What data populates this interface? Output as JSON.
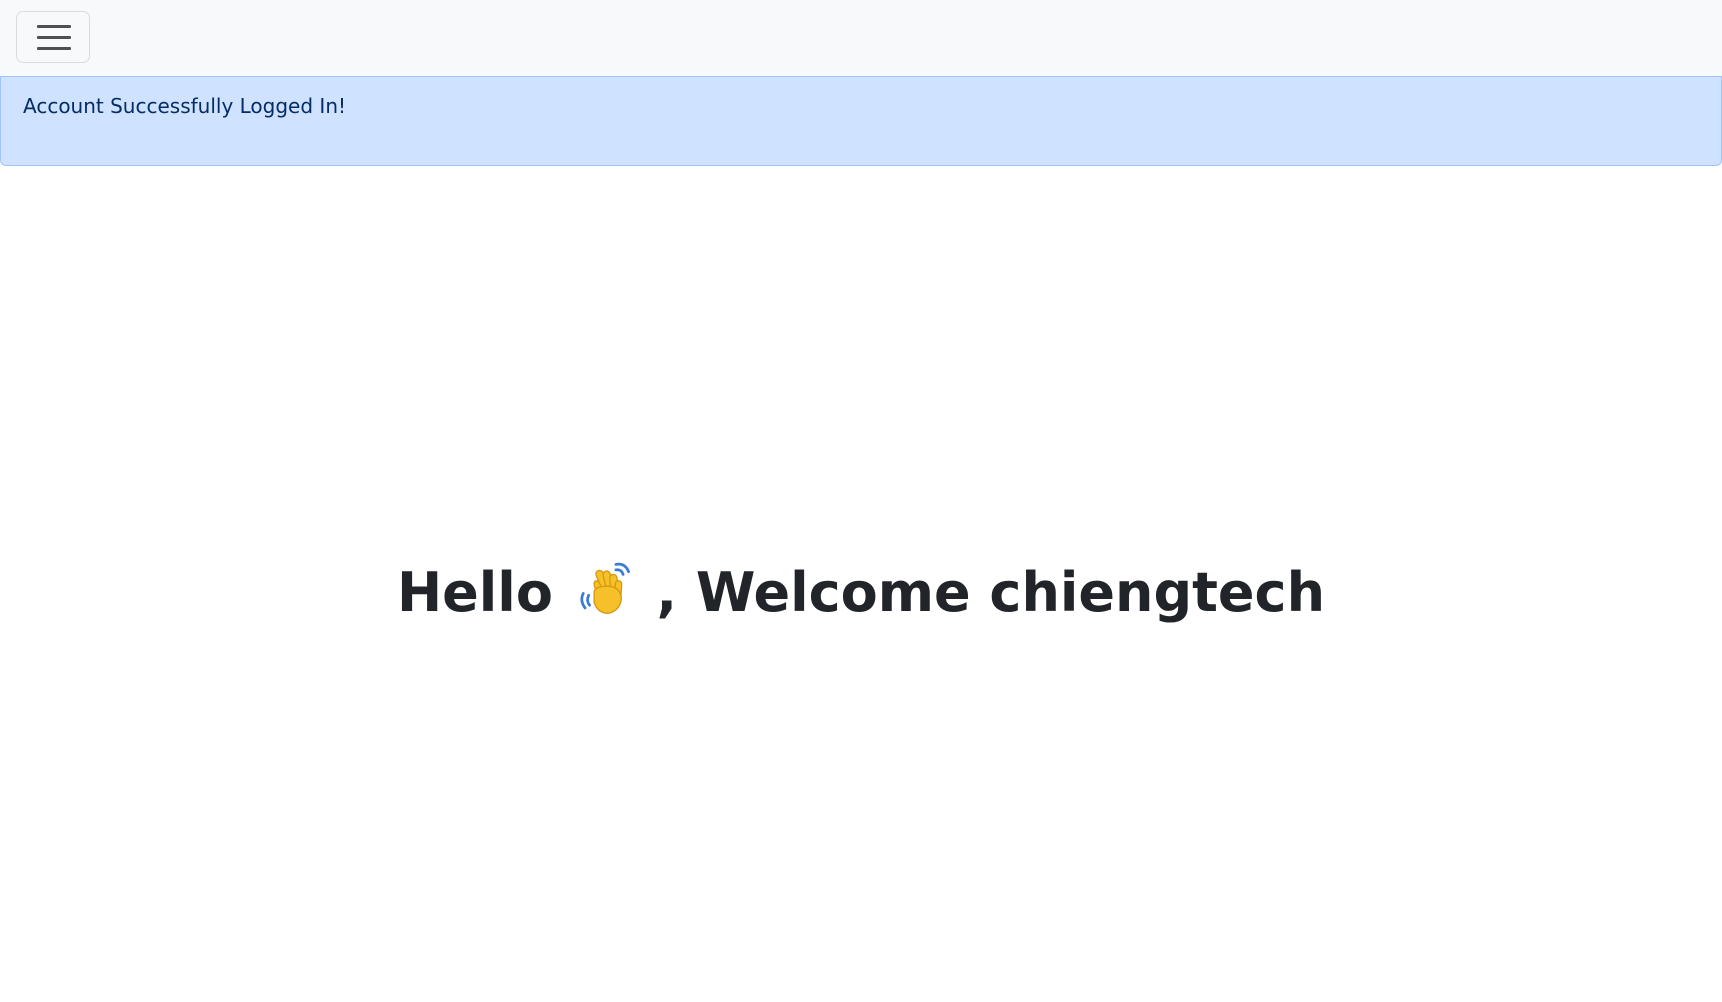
{
  "navbar": {
    "toggler_icon": "hamburger-menu-icon"
  },
  "alert": {
    "message": "Account Successfully Logged In!"
  },
  "welcome": {
    "hello": "Hello",
    "wave_icon": "waving-hand-icon",
    "welcome_text": ", Welcome chiengtech"
  },
  "colors": {
    "navbar_bg": "#f8f9fa",
    "alert_bg": "#cfe2ff",
    "alert_border": "#9ec5fe",
    "alert_text": "#052c65",
    "heading_text": "#212529"
  }
}
